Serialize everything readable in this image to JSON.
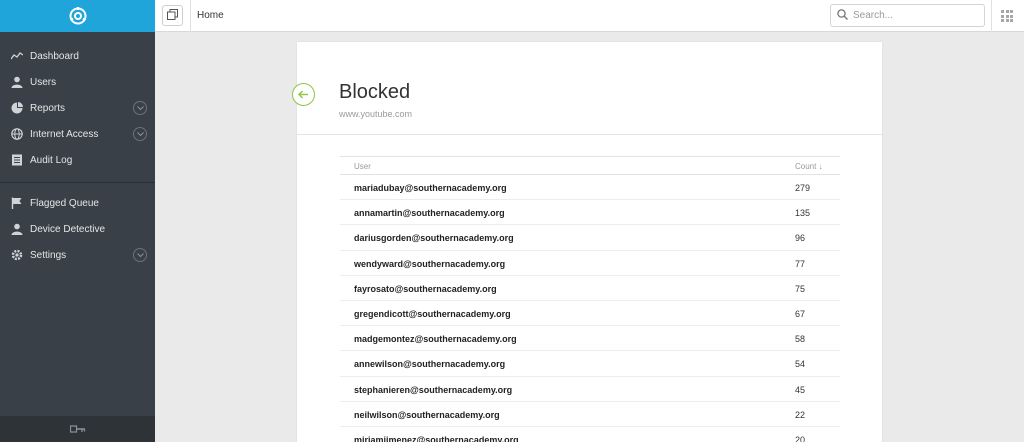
{
  "topbar": {
    "breadcrumb": "Home",
    "search_placeholder": "Search..."
  },
  "sidebar": {
    "items": [
      {
        "label": "Dashboard",
        "icon": "chart-line-icon"
      },
      {
        "label": "Users",
        "icon": "user-icon"
      },
      {
        "label": "Reports",
        "icon": "pie-chart-icon",
        "expandable": true
      },
      {
        "label": "Internet Access",
        "icon": "globe-icon",
        "expandable": true
      },
      {
        "label": "Audit Log",
        "icon": "list-icon"
      },
      {
        "label": "Flagged Queue",
        "icon": "flag-icon"
      },
      {
        "label": "Device Detective",
        "icon": "user-icon"
      },
      {
        "label": "Settings",
        "icon": "gear-icon",
        "expandable": true
      }
    ]
  },
  "page": {
    "title": "Blocked",
    "subtitle": "www.youtube.com"
  },
  "table": {
    "col_user": "User",
    "col_count": "Count ↓",
    "rows": [
      {
        "user": "mariadubay@southernacademy.org",
        "count": "279"
      },
      {
        "user": "annamartin@southernacademy.org",
        "count": "135"
      },
      {
        "user": "dariusgorden@southernacademy.org",
        "count": "96"
      },
      {
        "user": "wendyward@southernacademy.org",
        "count": "77"
      },
      {
        "user": "fayrosato@southernacademy.org",
        "count": "75"
      },
      {
        "user": "gregendicott@southernacademy.org",
        "count": "67"
      },
      {
        "user": "madgemontez@southernacademy.org",
        "count": "58"
      },
      {
        "user": "annewilson@southernacademy.org",
        "count": "54"
      },
      {
        "user": "stephanieren@southernacademy.org",
        "count": "45"
      },
      {
        "user": "neilwilson@southernacademy.org",
        "count": "22"
      },
      {
        "user": "miriamjimenez@southernacademy.org",
        "count": "20"
      }
    ]
  },
  "colors": {
    "brand": "#1fa5d9",
    "sidebar": "#3a4047",
    "accent_green": "#8dc63f"
  }
}
